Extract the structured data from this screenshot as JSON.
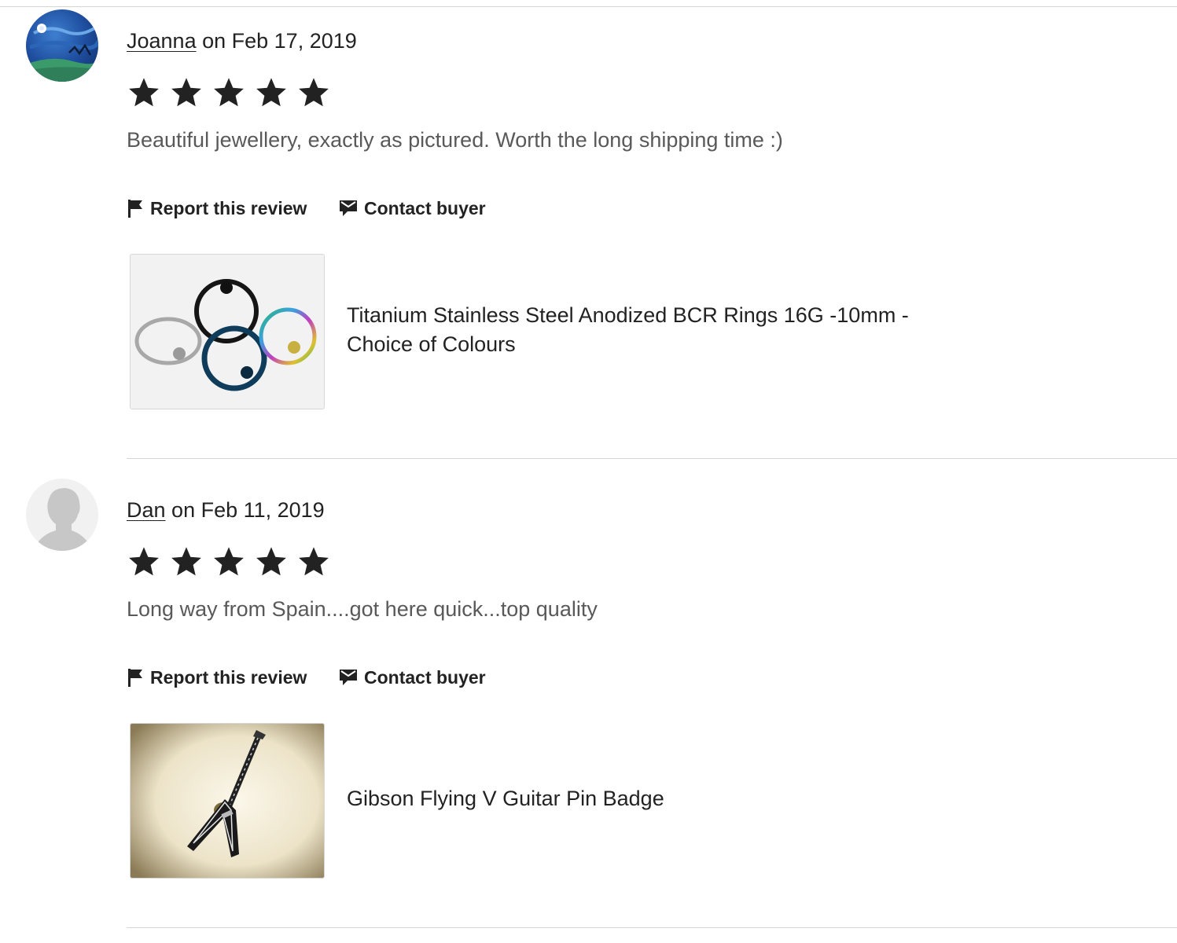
{
  "colors": {
    "text": "#222222",
    "muted": "#595959",
    "divider": "#d5d5d5",
    "star": "#222222"
  },
  "reviews": [
    {
      "avatar_icon": "avatar-painting",
      "author": "Joanna",
      "date": "on Feb 17, 2019",
      "rating": 5,
      "text": "Beautiful jewellery, exactly as pictured. Worth the long shipping time :)",
      "report_label": "Report this review",
      "contact_label": "Contact buyer",
      "listing": {
        "title": "Titanium Stainless Steel Anodized BCR Rings 16G -10mm - Choice of Colours",
        "image_icon": "rings-thumbnail"
      }
    },
    {
      "avatar_icon": "default-user-silhouette",
      "author": "Dan",
      "date": "on Feb 11, 2019",
      "rating": 5,
      "text": "Long way from Spain....got here quick...top quality",
      "report_label": "Report this review",
      "contact_label": "Contact buyer",
      "listing": {
        "title": "Gibson Flying V Guitar Pin Badge",
        "image_icon": "guitar-pin-thumbnail"
      }
    }
  ]
}
